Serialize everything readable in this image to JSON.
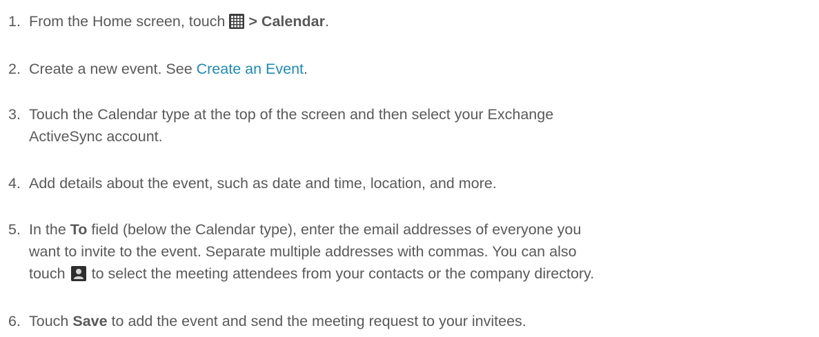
{
  "steps": [
    {
      "number": "1.",
      "pre": "From the Home screen, touch",
      "icon": "apps-grid-icon",
      "bold": "> Calendar",
      "post": "."
    },
    {
      "number": "2.",
      "pre": "Create a new event. See ",
      "link": "Create an Event",
      "post": "."
    },
    {
      "number": "3.",
      "line1": "Touch the Calendar type at the top of the screen and then select your Exchange",
      "line2": "ActiveSync account."
    },
    {
      "number": "4.",
      "text": "Add details about the event, such as date and time, location, and more."
    },
    {
      "number": "5.",
      "line1_pre": "In the ",
      "line1_bold": "To",
      "line1_post": " field (below the Calendar type), enter the email addresses of everyone you",
      "line2": "want to invite to the event. Separate multiple addresses with commas. You can also",
      "line3_pre": "touch",
      "icon": "contact-person-icon",
      "line3_post": "to select the meeting attendees from your contacts or the company directory."
    },
    {
      "number": "6.",
      "pre": "Touch ",
      "bold": "Save",
      "post": " to add the event and send the meeting request to your invitees."
    }
  ]
}
